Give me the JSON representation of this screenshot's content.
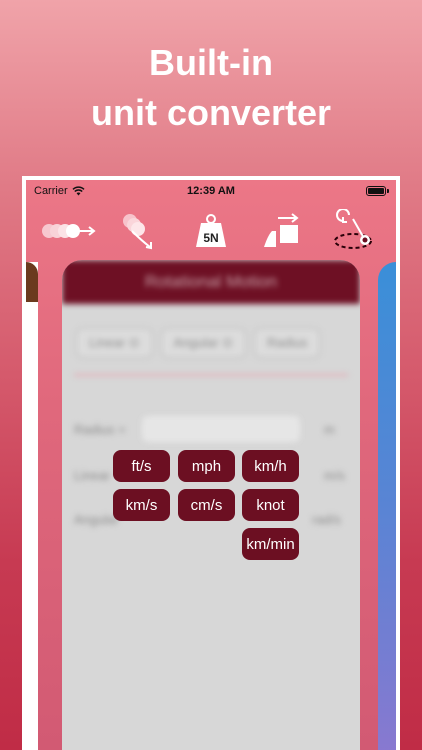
{
  "headline": {
    "line1": "Built-in",
    "line2": "unit converter"
  },
  "status": {
    "carrier": "Carrier",
    "time": "12:39 AM"
  },
  "toolbar": {
    "items": [
      {
        "icon": "linear-motion-icon"
      },
      {
        "icon": "projectile-motion-icon"
      },
      {
        "icon": "force-weight-icon",
        "label": "5N"
      },
      {
        "icon": "work-energy-icon"
      },
      {
        "icon": "rotational-motion-icon"
      }
    ]
  },
  "card": {
    "title": "Rotational Motion",
    "tabs": [
      "Linear ⊙",
      "Angular ⊙",
      "Radius"
    ],
    "rows": [
      {
        "label": "Radius =",
        "unit": "m"
      },
      {
        "label": "Linear",
        "unit": "m/s"
      },
      {
        "label": "Angular",
        "unit": "rad/s"
      }
    ]
  },
  "units": {
    "buttons": [
      "ft/s",
      "mph",
      "km/h",
      "km/s",
      "cm/s",
      "knot",
      "km/min"
    ]
  },
  "colors": {
    "accent": "#6c0f22",
    "bg_top": "#f0a3a9",
    "bg_bottom": "#c02c46"
  }
}
